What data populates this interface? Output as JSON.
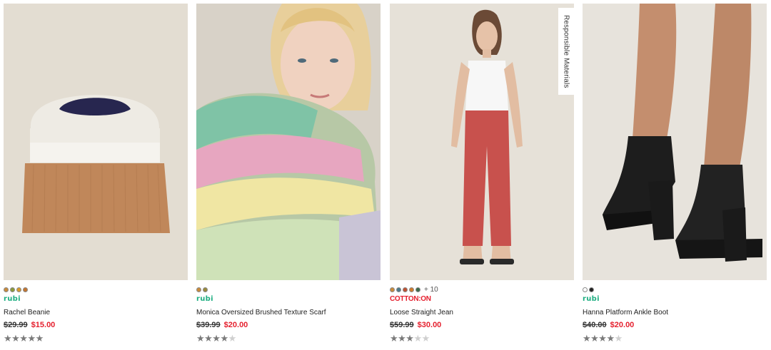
{
  "products": [
    {
      "name": "Rachel Beanie",
      "brand": "rubi",
      "price_was": "$29.99",
      "price_now": "$15.00",
      "rating_stars": 5,
      "swatch_colors": [
        "#c98a3a",
        "#8a9a3a",
        "#d79a2a",
        "#c4742e"
      ],
      "more_colors": ""
    },
    {
      "name": "Monica Oversized Brushed Texture Scarf",
      "brand": "rubi",
      "price_was": "$39.99",
      "price_now": "$20.00",
      "rating_stars": 4.5,
      "swatch_colors": [
        "#c98a3a",
        "#9a8a3a"
      ],
      "more_colors": ""
    },
    {
      "name": "Loose Straight Jean",
      "brand": "COTTON:ON",
      "price_was": "$59.99",
      "price_now": "$30.00",
      "rating_stars": 3,
      "swatch_colors": [
        "#c98a3a",
        "#4a7a8a",
        "#c05030",
        "#d07a2a",
        "#3a6a4a"
      ],
      "more_colors": "+ 10",
      "side_badge": "Responsible Materials"
    },
    {
      "name": "Hanna Platform Ankle Boot",
      "brand": "rubi",
      "price_was": "$40.00",
      "price_now": "$20.00",
      "rating_stars": 4.5,
      "swatch_colors": [
        "#ffffff",
        "#222222"
      ],
      "more_colors": ""
    }
  ],
  "colors": {
    "sale_red": "#e5202e",
    "rubi_green": "#1fae82",
    "cotton_on_red": "#e5202e"
  }
}
